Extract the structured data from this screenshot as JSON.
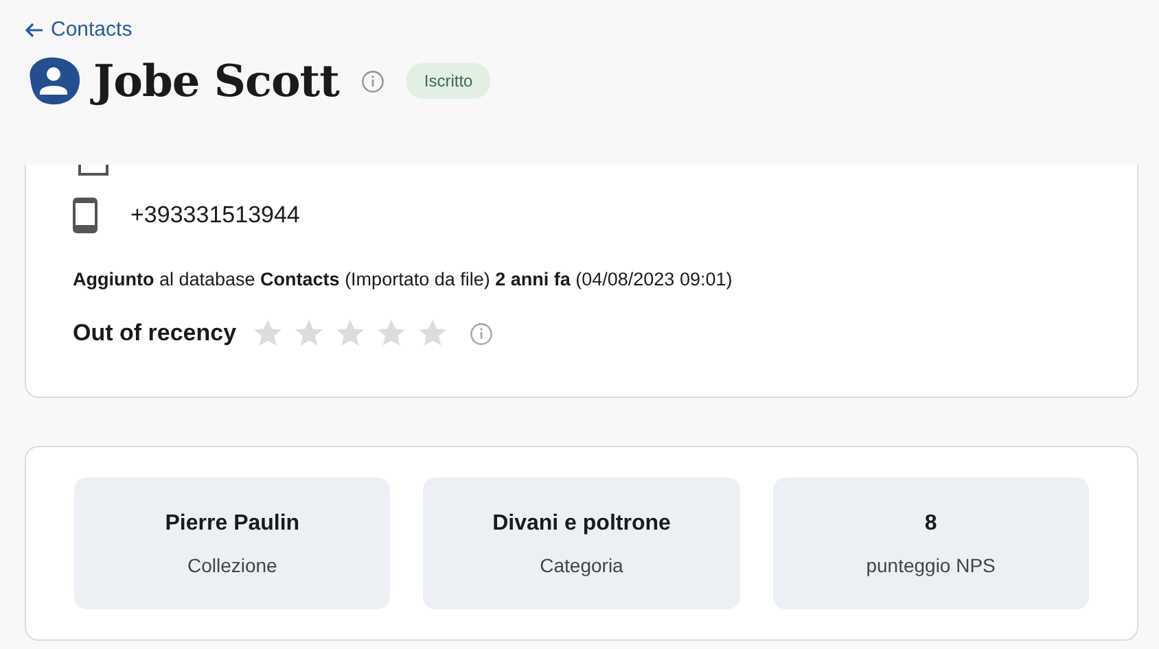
{
  "back_link": {
    "label": "Contacts"
  },
  "contact": {
    "name": "Jobe Scott",
    "status_badge": "Iscritto"
  },
  "details": {
    "phone": "+393331513944",
    "added_note": "**Aggiunto** al database **Contacts** (Importato da file) **2 anni fa** (04/08/2023 09:01)",
    "recency": {
      "label": "Out of recency",
      "stars": 0
    }
  },
  "stats": [
    {
      "value": "Pierre Paulin",
      "label": "Collezione"
    },
    {
      "value": "Divani e poltrone",
      "label": "Categoria"
    },
    {
      "value": "8",
      "label": "punteggio NPS"
    }
  ]
}
